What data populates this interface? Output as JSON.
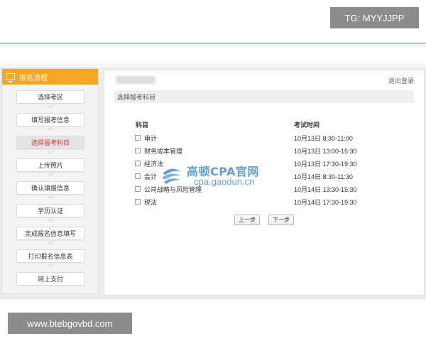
{
  "overlay": {
    "tg_text": "TG: MYYJJPP",
    "url_text": "www.btebgovbd.com"
  },
  "sidebar": {
    "header": "报名流程",
    "steps": [
      {
        "label": "选择考区",
        "active": false
      },
      {
        "label": "填写报考信息",
        "active": false
      },
      {
        "label": "选择报考科目",
        "active": true
      },
      {
        "label": "上传照片",
        "active": false
      },
      {
        "label": "确认填报信息",
        "active": false
      },
      {
        "label": "学历认证",
        "active": false
      },
      {
        "label": "完成报名信息填写",
        "active": false
      },
      {
        "label": "打印报名信息表",
        "active": false
      },
      {
        "label": "网上支付",
        "active": false
      }
    ]
  },
  "main": {
    "logout": "退出登录",
    "section_title": "选择报考科目",
    "col_subject": "科目",
    "col_time": "考试时间",
    "rows": [
      {
        "subject": "审计",
        "time": "10月13日 8:30-11:00"
      },
      {
        "subject": "财务成本管理",
        "time": "10月13日 13:00-15:30"
      },
      {
        "subject": "经济法",
        "time": "10月13日 17:30-19:30"
      },
      {
        "subject": "会计",
        "time": "10月14日 8:30-11:30"
      },
      {
        "subject": "公司战略与风险管理",
        "time": "10月14日 13:30-15:30"
      },
      {
        "subject": "税法",
        "time": "10月14日 17:30-19:30"
      }
    ],
    "prev_button": "上一步",
    "next_button": "下一步"
  },
  "watermark": {
    "title": "高顿CPA官网",
    "url": "cpa.gaodun.cn"
  },
  "colors": {
    "accent": "#f5a623",
    "active_step_text": "#d2363a",
    "watermark_blue": "#2f7fc6"
  }
}
